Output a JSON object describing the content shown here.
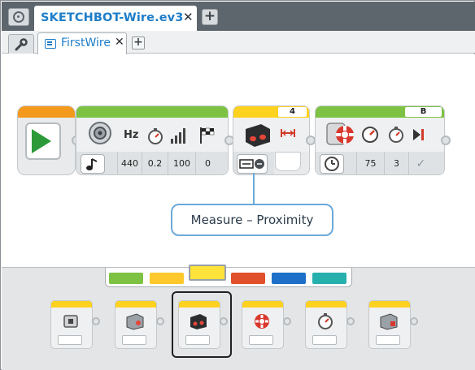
{
  "titlebar": {
    "project_title": "SKETCHBOT-Wire.ev3",
    "close_glyph": "✕",
    "add_glyph": "+"
  },
  "tabs": {
    "program_label": "FirstWire",
    "close_glyph": "✕",
    "add_glyph": "+"
  },
  "canvas": {
    "sound_block": {
      "params": [
        "Hz",
        "",
        "",
        ""
      ],
      "values": [
        "440",
        "0.2",
        "100",
        "0"
      ]
    },
    "sensor_block": {
      "port": "4"
    },
    "move_block": {
      "port": "B",
      "values": [
        "75",
        "3",
        "✓"
      ]
    },
    "callout": "Measure – Proximity"
  },
  "palette": {
    "tab_colors": [
      "#7dc242",
      "#ffc82c",
      "#ffe23a",
      "#e0502b",
      "#1d6fc7",
      "#25b0ae"
    ],
    "active_tab_index": 2
  },
  "colors": {
    "accent": "#1e7dc8",
    "action_green": "#7dc242",
    "flow_orange": "#f39a1d",
    "sensor_yellow": "#ffd21f"
  }
}
